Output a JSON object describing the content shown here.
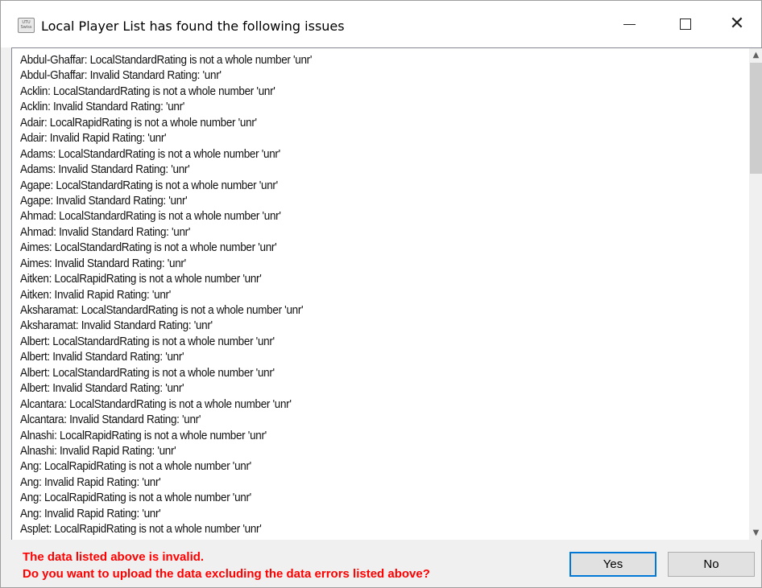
{
  "window": {
    "title": "Local Player List has found the following issues",
    "icon_name": "app-icon",
    "icon_text": "UTU Swiss",
    "controls": {
      "minimize": "minimize-icon",
      "maximize": "maximize-icon",
      "close": "close-icon",
      "close_glyph": "✕"
    }
  },
  "issues": [
    "Abdul-Ghaffar: LocalStandardRating is not a whole number 'unr'",
    "Abdul-Ghaffar: Invalid Standard Rating: 'unr'",
    "Acklin: LocalStandardRating is not a whole number 'unr'",
    "Acklin: Invalid Standard Rating: 'unr'",
    "Adair: LocalRapidRating is not a whole number 'unr'",
    "Adair: Invalid Rapid Rating: 'unr'",
    "Adams: LocalStandardRating is not a whole number 'unr'",
    "Adams: Invalid Standard Rating: 'unr'",
    "Agape: LocalStandardRating is not a whole number 'unr'",
    "Agape: Invalid Standard Rating: 'unr'",
    "Ahmad: LocalStandardRating is not a whole number 'unr'",
    "Ahmad: Invalid Standard Rating: 'unr'",
    "Aimes: LocalStandardRating is not a whole number 'unr'",
    "Aimes: Invalid Standard Rating: 'unr'",
    "Aitken: LocalRapidRating is not a whole number 'unr'",
    "Aitken: Invalid Rapid Rating: 'unr'",
    "Aksharamat: LocalStandardRating is not a whole number 'unr'",
    "Aksharamat: Invalid Standard Rating: 'unr'",
    "Albert: LocalStandardRating is not a whole number 'unr'",
    "Albert: Invalid Standard Rating: 'unr'",
    "Albert: LocalStandardRating is not a whole number 'unr'",
    "Albert: Invalid Standard Rating: 'unr'",
    "Alcantara: LocalStandardRating is not a whole number 'unr'",
    "Alcantara: Invalid Standard Rating: 'unr'",
    "Alnashi: LocalRapidRating is not a whole number 'unr'",
    "Alnashi: Invalid Rapid Rating: 'unr'",
    "Ang: LocalRapidRating is not a whole number 'unr'",
    "Ang: Invalid Rapid Rating: 'unr'",
    "Ang: LocalRapidRating is not a whole number 'unr'",
    "Ang: Invalid Rapid Rating: 'unr'",
    "Asplet: LocalRapidRating is not a whole number 'unr'"
  ],
  "scrollbar": {
    "up_icon": "scroll-up-arrow-icon",
    "down_icon": "scroll-down-arrow-icon",
    "up_glyph": "▲",
    "down_glyph": "▼"
  },
  "footer": {
    "message_line1": "The data listed above is invalid.",
    "message_line2": "Do you want to upload the data excluding the data errors listed above?",
    "message_color": "#ff0000",
    "yes_label": "Yes",
    "no_label": "No",
    "accent_color": "#0078d7"
  }
}
